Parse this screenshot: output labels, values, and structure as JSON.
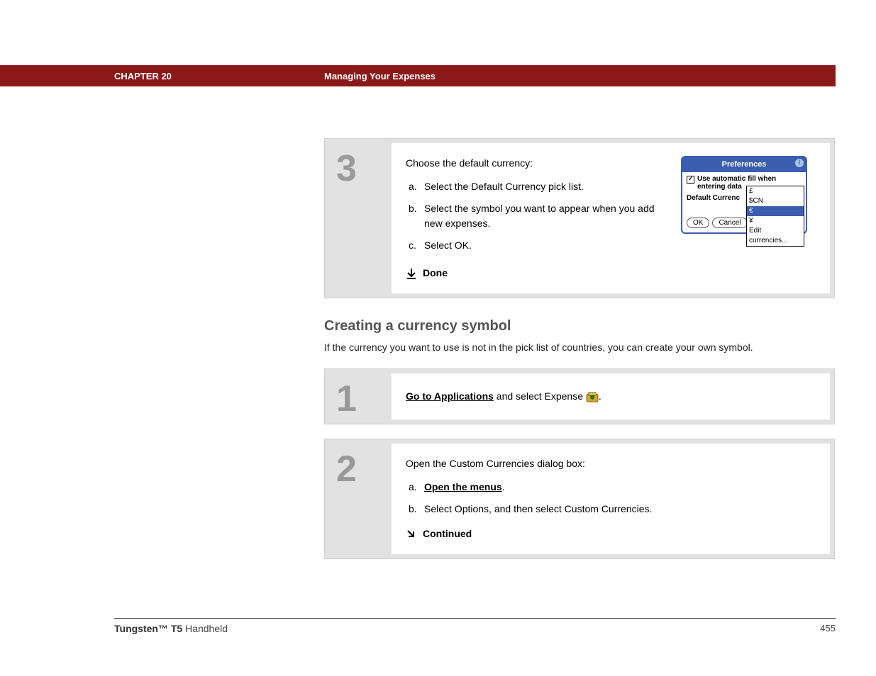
{
  "header": {
    "chapter": "CHAPTER 20",
    "title": "Managing Your Expenses"
  },
  "step3": {
    "num": "3",
    "intro": "Choose the default currency:",
    "a_label": "a.",
    "a_text": "Select the Default Currency pick list.",
    "b_label": "b.",
    "b_text": "Select the symbol you want to appear when you add new expenses.",
    "c_label": "c.",
    "c_text": "Select OK.",
    "done": "Done"
  },
  "palm": {
    "title": "Preferences",
    "info": "i",
    "check_mark": "✓",
    "check_label": "Use automatic fill when entering data",
    "default_currency_label": "Default Currenc",
    "ok": "OK",
    "cancel": "Cancel",
    "options": {
      "pound": "£",
      "scn": "$CN",
      "euro": "€",
      "yen": "¥",
      "edit": "Edit currencies..."
    }
  },
  "section": {
    "heading": "Creating a currency symbol",
    "para": "If the currency you want to use is not in the pick list of countries, you can create your own symbol."
  },
  "step1": {
    "num": "1",
    "link": "Go to Applications",
    "rest": " and select Expense ",
    "dot": "."
  },
  "step2": {
    "num": "2",
    "intro": "Open the Custom Currencies dialog box:",
    "a_label": "a.",
    "a_link": "Open the menus",
    "a_dot": ".",
    "b_label": "b.",
    "b_text": "Select Options, and then select Custom Currencies.",
    "continued": "Continued"
  },
  "footer": {
    "product_bold": "Tungsten™ T5",
    "product_rest": " Handheld",
    "page": "455"
  }
}
